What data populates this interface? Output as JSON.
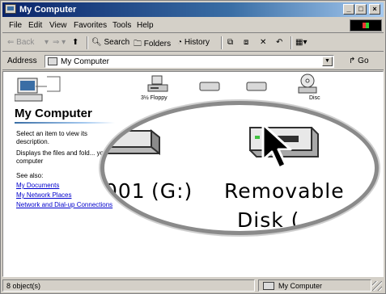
{
  "window": {
    "title": "My Computer",
    "controls": {
      "minimize": "_",
      "maximize": "□",
      "close": "×"
    }
  },
  "menu": {
    "items": [
      "File",
      "Edit",
      "View",
      "Favorites",
      "Tools",
      "Help"
    ]
  },
  "toolbar": {
    "back_label": "Back",
    "search_label": "Search",
    "folders_label": "Folders",
    "history_label": "History"
  },
  "address": {
    "label": "Address",
    "value": "My Computer",
    "go_label": "Go"
  },
  "left_pane": {
    "heading": "My Computer",
    "select_hint": "Select an item to view its description.",
    "displays_text": "Displays the files and fold... your computer",
    "see_also": "See also:",
    "links": [
      "My Documents",
      "My Network Places",
      "Network and Dial-up Connections"
    ]
  },
  "drives": {
    "floppy_label": "3½ Floppy",
    "disc_label": "Disc"
  },
  "magnified": {
    "left_label": "(G:)",
    "left_prefix": "001",
    "right_label": "Removable",
    "right_label_line2": "Disk (",
    "icon_names": [
      "drive-icon",
      "removable-disk-icon",
      "cursor-arrow-icon"
    ]
  },
  "status": {
    "objects": "8 object(s)",
    "location": "My Computer"
  },
  "colors": {
    "titlebar_start": "#0a246a",
    "titlebar_end": "#a6caf0",
    "chrome": "#d4d0c8",
    "link": "#0000cc"
  }
}
